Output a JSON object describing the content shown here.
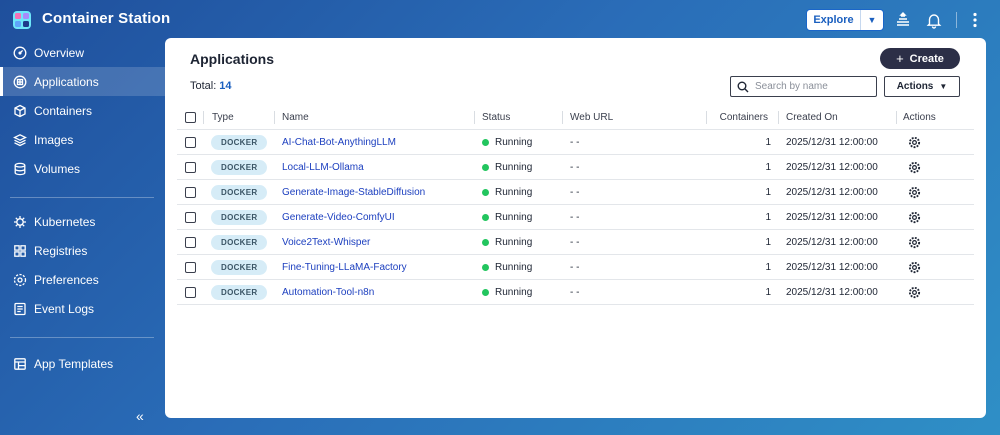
{
  "header": {
    "app_title": "Container Station",
    "explore_label": "Explore",
    "icons": [
      "app-logo-icon",
      "stack-icon",
      "bell-icon",
      "more-vertical-icon"
    ]
  },
  "sidebar": {
    "items": [
      {
        "label": "Overview",
        "icon": "dashboard-icon",
        "active": false
      },
      {
        "label": "Applications",
        "icon": "applications-icon",
        "active": true
      },
      {
        "label": "Containers",
        "icon": "cube-icon",
        "active": false
      },
      {
        "label": "Images",
        "icon": "layers-icon",
        "active": false
      },
      {
        "label": "Volumes",
        "icon": "database-icon",
        "active": false
      },
      {
        "label": "Kubernetes",
        "icon": "helm-icon",
        "active": false
      },
      {
        "label": "Registries",
        "icon": "registry-icon",
        "active": false
      },
      {
        "label": "Preferences",
        "icon": "gear-icon",
        "active": false
      },
      {
        "label": "Event Logs",
        "icon": "log-icon",
        "active": false
      },
      {
        "label": "App Templates",
        "icon": "template-icon",
        "active": false
      }
    ]
  },
  "panel": {
    "title": "Applications",
    "create_label": "Create",
    "total_label": "Total:",
    "total_count": "14",
    "search_placeholder": "Search by name",
    "actions_label": "Actions"
  },
  "table": {
    "columns": [
      "Type",
      "Name",
      "Status",
      "Web URL",
      "Containers",
      "Created On",
      "Actions"
    ],
    "rows": [
      {
        "type": "DOCKER",
        "name": "AI-Chat-Bot-AnythingLLM",
        "status": "Running",
        "web_url": "- -",
        "containers": "1",
        "created_on": "2025/12/31 12:00:00"
      },
      {
        "type": "DOCKER",
        "name": "Local-LLM-Ollama",
        "status": "Running",
        "web_url": "- -",
        "containers": "1",
        "created_on": "2025/12/31 12:00:00"
      },
      {
        "type": "DOCKER",
        "name": "Generate-Image-StableDiffusion",
        "status": "Running",
        "web_url": "- -",
        "containers": "1",
        "created_on": "2025/12/31 12:00:00"
      },
      {
        "type": "DOCKER",
        "name": "Generate-Video-ComfyUI",
        "status": "Running",
        "web_url": "- -",
        "containers": "1",
        "created_on": "2025/12/31 12:00:00"
      },
      {
        "type": "DOCKER",
        "name": "Voice2Text-Whisper",
        "status": "Running",
        "web_url": "- -",
        "containers": "1",
        "created_on": "2025/12/31 12:00:00"
      },
      {
        "type": "DOCKER",
        "name": "Fine-Tuning-LLaMA-Factory",
        "status": "Running",
        "web_url": "- -",
        "containers": "1",
        "created_on": "2025/12/31 12:00:00"
      },
      {
        "type": "DOCKER",
        "name": "Automation-Tool-n8n",
        "status": "Running",
        "web_url": "- -",
        "containers": "1",
        "created_on": "2025/12/31 12:00:00"
      }
    ]
  },
  "colors": {
    "status_running": "#22c55e",
    "link": "#1c3fbf",
    "create_bg": "#2c2f47",
    "badge_bg": "#d6ecf7"
  }
}
